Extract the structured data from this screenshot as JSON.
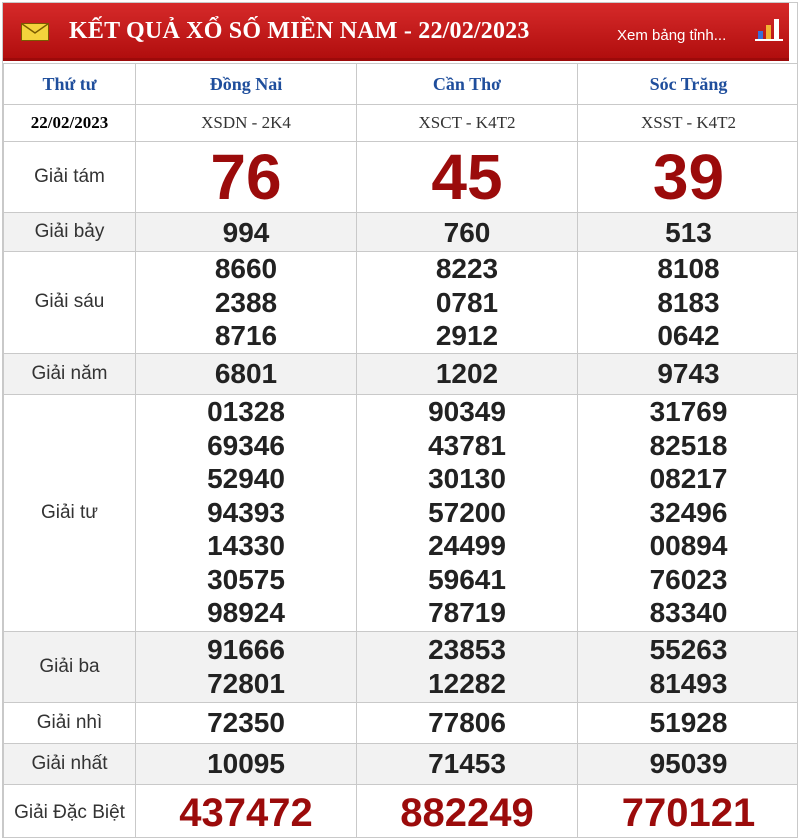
{
  "header": {
    "title": "KẾT QUẢ XỔ SỐ MIỀN NAM - 22/02/2023",
    "view_link": "Xem bảng tỉnh...",
    "icons": [
      "envelope-icon",
      "bar-chart-icon"
    ],
    "colors": {
      "header_bg": "#c41a1a",
      "prize_red": "#9b0b0b",
      "province_blue": "#1f4e9c"
    }
  },
  "table": {
    "day_label": "Thứ tư",
    "date": "22/02/2023",
    "provinces": [
      {
        "name": "Đồng Nai",
        "code": "XSDN - 2K4"
      },
      {
        "name": "Cần Thơ",
        "code": "XSCT - K4T2"
      },
      {
        "name": "Sóc Trăng",
        "code": "XSST - K4T2"
      }
    ],
    "prizes": {
      "g8": {
        "label": "Giải tám",
        "values": [
          "76",
          "45",
          "39"
        ]
      },
      "g7": {
        "label": "Giải bảy",
        "values": [
          "994",
          "760",
          "513"
        ]
      },
      "g6": {
        "label": "Giải sáu",
        "values": [
          [
            "8660",
            "2388",
            "8716"
          ],
          [
            "8223",
            "0781",
            "2912"
          ],
          [
            "8108",
            "8183",
            "0642"
          ]
        ]
      },
      "g5": {
        "label": "Giải năm",
        "values": [
          "6801",
          "1202",
          "9743"
        ]
      },
      "g4": {
        "label": "Giải tư",
        "values": [
          [
            "01328",
            "69346",
            "52940",
            "94393",
            "14330",
            "30575",
            "98924"
          ],
          [
            "90349",
            "43781",
            "30130",
            "57200",
            "24499",
            "59641",
            "78719"
          ],
          [
            "31769",
            "82518",
            "08217",
            "32496",
            "00894",
            "76023",
            "83340"
          ]
        ]
      },
      "g3": {
        "label": "Giải ba",
        "values": [
          [
            "91666",
            "72801"
          ],
          [
            "23853",
            "12282"
          ],
          [
            "55263",
            "81493"
          ]
        ]
      },
      "g2": {
        "label": "Giải nhì",
        "values": [
          "72350",
          "77806",
          "51928"
        ]
      },
      "g1": {
        "label": "Giải nhất",
        "values": [
          "10095",
          "71453",
          "95039"
        ]
      },
      "db": {
        "label": "Giải Đặc Biệt",
        "values": [
          "437472",
          "882249",
          "770121"
        ]
      }
    }
  }
}
